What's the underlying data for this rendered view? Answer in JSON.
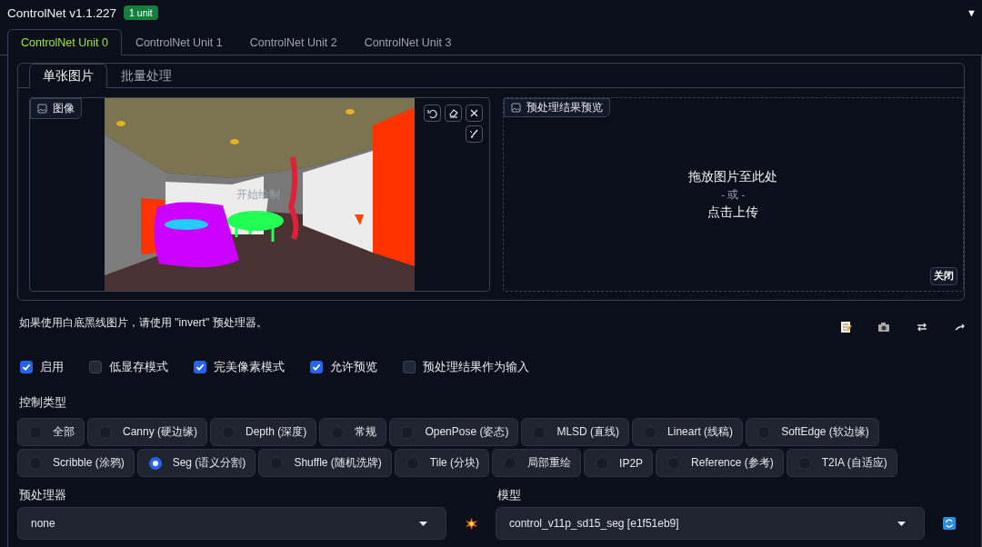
{
  "header": {
    "title": "ControlNet v1.1.227",
    "badge": "1 unit",
    "collapse_toggle": "▼"
  },
  "unit_tabs": [
    {
      "label": "ControlNet Unit 0",
      "selected": true
    },
    {
      "label": "ControlNet Unit 1",
      "selected": false
    },
    {
      "label": "ControlNet Unit 2",
      "selected": false
    },
    {
      "label": "ControlNet Unit 3",
      "selected": false
    }
  ],
  "image_tabs": [
    {
      "label": "单张图片",
      "selected": true
    },
    {
      "label": "批量处理",
      "selected": false
    }
  ],
  "image_panel": {
    "label": "图像",
    "canvas_hint": "开始绘制"
  },
  "preview_panel": {
    "label": "预处理结果预览",
    "drop_text": "拖放图片至此处",
    "or_text": "- 或 -",
    "upload_text": "点击上传",
    "close_button": "关闭"
  },
  "hint": "如果使用白底黑线图片，请使用 \"invert\" 预处理器。",
  "options": [
    {
      "label": "启用",
      "checked": true
    },
    {
      "label": "低显存模式",
      "checked": false
    },
    {
      "label": "完美像素模式",
      "checked": true
    },
    {
      "label": "允许预览",
      "checked": true
    },
    {
      "label": "预处理结果作为输入",
      "checked": false
    }
  ],
  "control_type": {
    "label": "控制类型",
    "options": [
      {
        "label": "全部",
        "selected": false
      },
      {
        "label": "Canny (硬边缘)",
        "selected": false
      },
      {
        "label": "Depth (深度)",
        "selected": false
      },
      {
        "label": "常规",
        "selected": false
      },
      {
        "label": "OpenPose (姿态)",
        "selected": false
      },
      {
        "label": "MLSD (直线)",
        "selected": false
      },
      {
        "label": "Lineart (线稿)",
        "selected": false
      },
      {
        "label": "SoftEdge (软边缘)",
        "selected": false
      },
      {
        "label": "Scribble (涂鸦)",
        "selected": false
      },
      {
        "label": "Seg (语义分割)",
        "selected": true
      },
      {
        "label": "Shuffle (随机洗牌)",
        "selected": false
      },
      {
        "label": "Tile (分块)",
        "selected": false
      },
      {
        "label": "局部重绘",
        "selected": false
      },
      {
        "label": "IP2P",
        "selected": false
      },
      {
        "label": "Reference (参考)",
        "selected": false
      },
      {
        "label": "T2IA (自适应)",
        "selected": false
      }
    ]
  },
  "preprocessor": {
    "label": "预处理器",
    "value": "none"
  },
  "model": {
    "label": "模型",
    "value": "control_v11p_sd15_seg [e1f51eb9]"
  }
}
